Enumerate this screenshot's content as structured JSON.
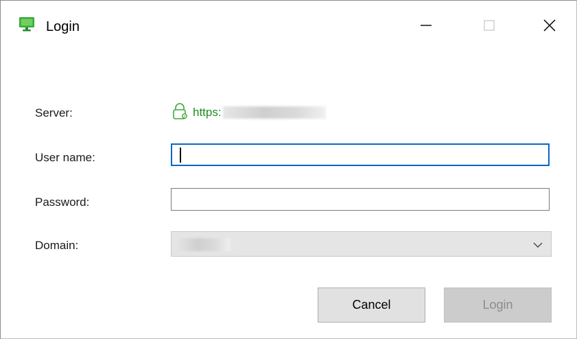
{
  "window": {
    "title": "Login",
    "icon": "monitor-icon",
    "controls": {
      "minimize_icon": "minimize-icon",
      "maximize_icon": "maximize-icon",
      "close_icon": "close-icon"
    }
  },
  "form": {
    "server_label": "Server:",
    "server_value": "https:",
    "server_icon": "lock-icon",
    "username_label": "User name:",
    "username_value": "",
    "password_label": "Password:",
    "password_value": "",
    "domain_label": "Domain:",
    "domain_icon": "chevron-down-icon"
  },
  "buttons": {
    "cancel": "Cancel",
    "login": "Login"
  },
  "colors": {
    "accent": "#0a64c8",
    "server_text": "#1e8c1e",
    "app_icon": "#3aa83a"
  }
}
